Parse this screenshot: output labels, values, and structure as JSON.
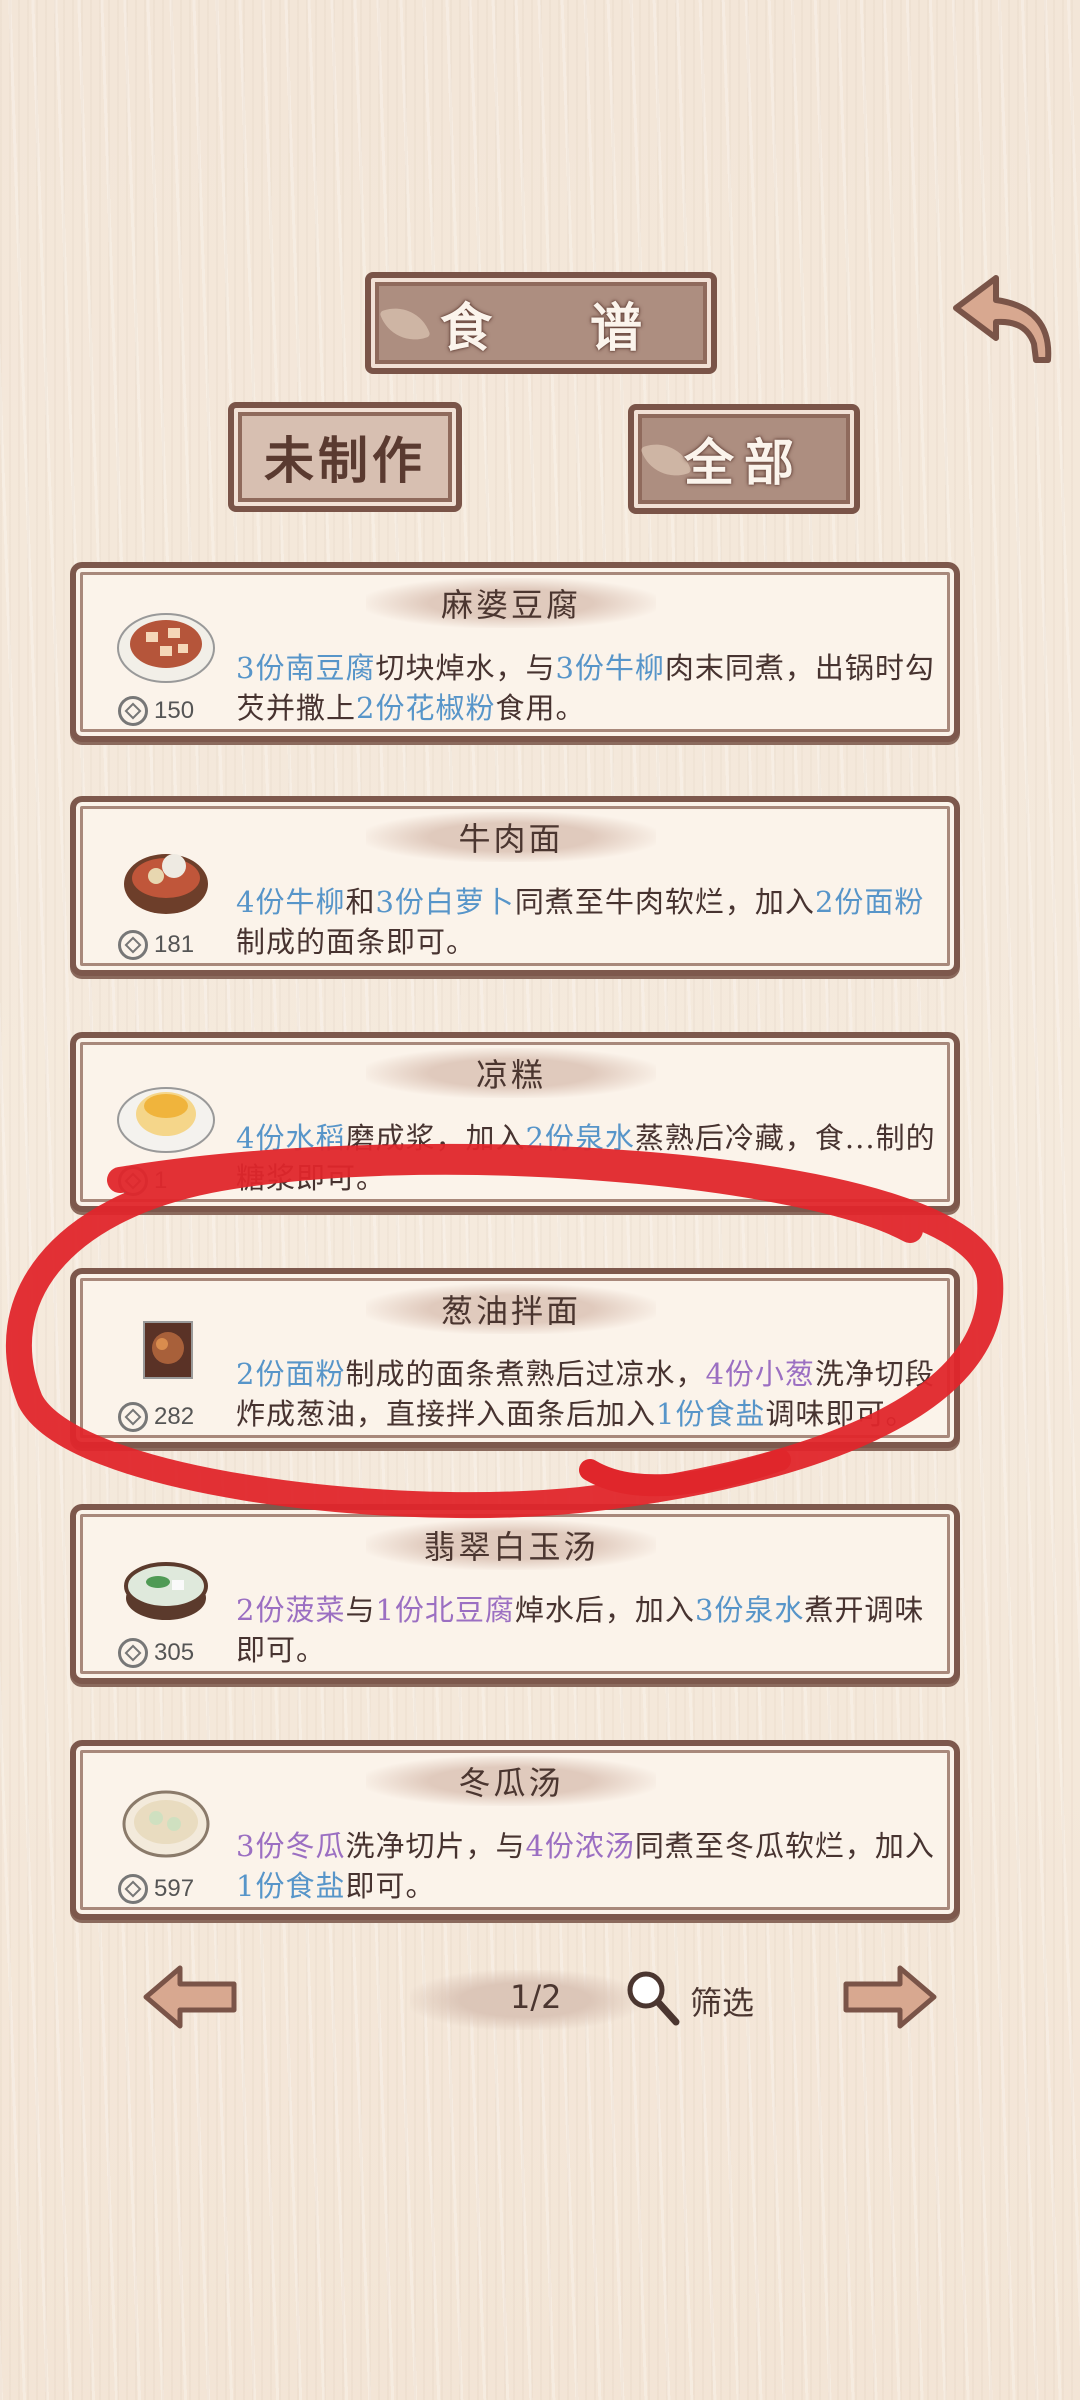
{
  "header": {
    "title": "食 谱",
    "tab_unmade": "未制作",
    "tab_all": "全部"
  },
  "recipes": [
    {
      "name": "麻婆豆腐",
      "price": "150",
      "desc": [
        {
          "t": "3份南豆腐",
          "c": "blue"
        },
        {
          "t": "切块焯水，与",
          "c": ""
        },
        {
          "t": "3份牛柳",
          "c": "blue"
        },
        {
          "t": "肉末同煮，出锅时勾芡并撒上",
          "c": ""
        },
        {
          "t": "2份花椒粉",
          "c": "blue"
        },
        {
          "t": "食用。",
          "c": ""
        }
      ]
    },
    {
      "name": "牛肉面",
      "price": "181",
      "desc": [
        {
          "t": "4份牛柳",
          "c": "blue"
        },
        {
          "t": "和",
          "c": ""
        },
        {
          "t": "3份白萝卜",
          "c": "blue"
        },
        {
          "t": "同煮至牛肉软烂，加入",
          "c": ""
        },
        {
          "t": "2份面粉",
          "c": "blue"
        },
        {
          "t": "制成的面条即可。",
          "c": ""
        }
      ]
    },
    {
      "name": "凉糕",
      "price": "1",
      "desc": [
        {
          "t": "4份水稻",
          "c": "blue"
        },
        {
          "t": "磨成浆，加入",
          "c": ""
        },
        {
          "t": "2份泉水",
          "c": "blue"
        },
        {
          "t": "蒸熟后冷藏，食...制的糖浆即可。",
          "c": ""
        }
      ]
    },
    {
      "name": "葱油拌面",
      "price": "282",
      "desc": [
        {
          "t": "2份面粉",
          "c": "blue"
        },
        {
          "t": "制成的面条煮熟后过凉水，",
          "c": ""
        },
        {
          "t": "4份小葱",
          "c": "purple"
        },
        {
          "t": "洗净切段炸成葱油，直接拌入面条后加入",
          "c": ""
        },
        {
          "t": "1份食盐",
          "c": "blue"
        },
        {
          "t": "调味即可。",
          "c": ""
        }
      ]
    },
    {
      "name": "翡翠白玉汤",
      "price": "305",
      "desc": [
        {
          "t": "2份菠菜",
          "c": "purple"
        },
        {
          "t": "与",
          "c": ""
        },
        {
          "t": "1份北豆腐",
          "c": "purple"
        },
        {
          "t": "焯水后，加入",
          "c": ""
        },
        {
          "t": "3份泉水",
          "c": "blue"
        },
        {
          "t": "煮开调味即可。",
          "c": ""
        }
      ]
    },
    {
      "name": "冬瓜汤",
      "price": "597",
      "desc": [
        {
          "t": "3份冬瓜",
          "c": "purple"
        },
        {
          "t": "洗净切片，与",
          "c": ""
        },
        {
          "t": "4份浓汤",
          "c": "purple"
        },
        {
          "t": "同煮至冬瓜软烂，加入",
          "c": ""
        },
        {
          "t": "1份食盐",
          "c": "blue"
        },
        {
          "t": "即可。",
          "c": ""
        }
      ]
    }
  ],
  "footer": {
    "page": "1/2",
    "filter_label": "筛选"
  },
  "icons": [
    "back-arrow-icon",
    "coin-icon",
    "magnifier-icon",
    "prev-arrow-icon",
    "next-arrow-icon"
  ],
  "colors": {
    "accent_blue": "#5795c9",
    "accent_purple": "#9b6fc2",
    "frame": "#7d584c",
    "annotation_red": "#e0262b"
  }
}
